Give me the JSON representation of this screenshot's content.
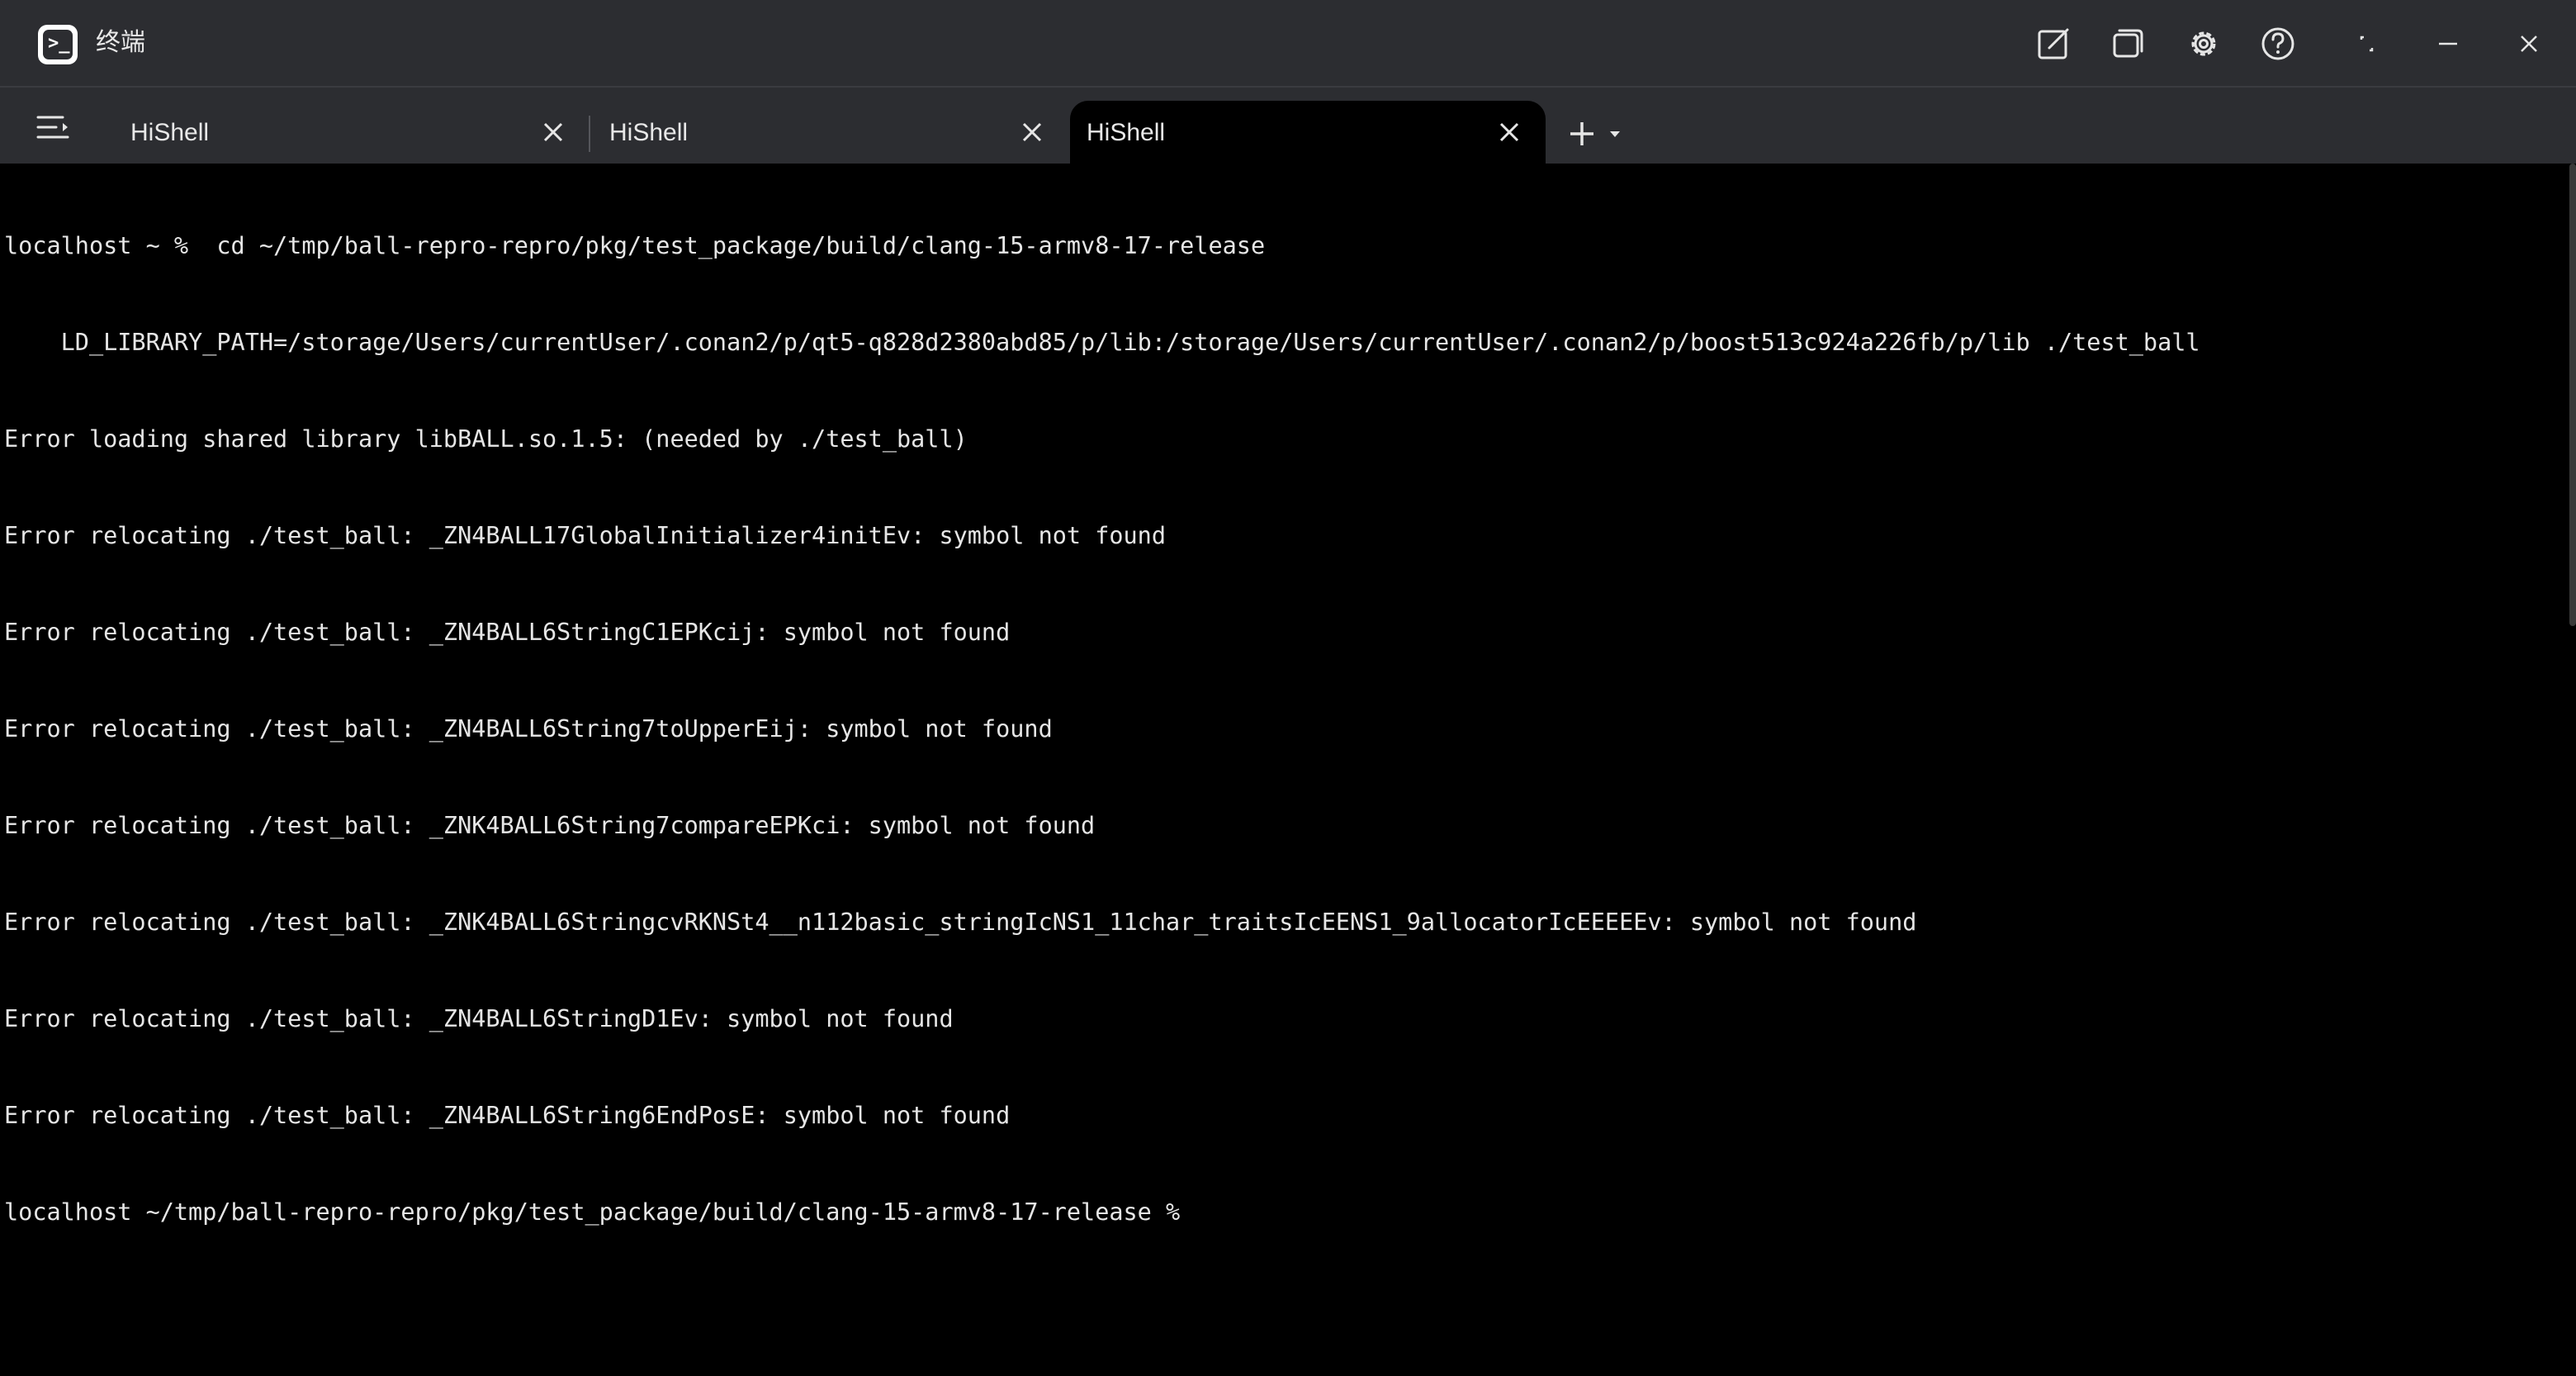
{
  "window": {
    "title": "终端",
    "app_icon": "terminal-app-icon",
    "controls": [
      {
        "name": "new-window-icon"
      },
      {
        "name": "split-windows-icon"
      },
      {
        "name": "settings-gear-icon"
      },
      {
        "name": "help-icon"
      },
      {
        "name": "restore-icon"
      },
      {
        "name": "minimize-icon"
      },
      {
        "name": "close-icon"
      }
    ]
  },
  "tabs": [
    {
      "label": "HiShell",
      "active": false
    },
    {
      "label": "HiShell",
      "active": false
    },
    {
      "label": "HiShell",
      "active": true
    }
  ],
  "tabbar": {
    "menu_icon": "tab-menu-icon",
    "add_icon": "add-tab-icon",
    "dropdown_icon": "dropdown-caret-icon"
  },
  "terminal": {
    "lines": [
      "localhost ~ %  cd ~/tmp/ball-repro-repro/pkg/test_package/build/clang-15-armv8-17-release",
      "    LD_LIBRARY_PATH=/storage/Users/currentUser/.conan2/p/qt5-q828d2380abd85/p/lib:/storage/Users/currentUser/.conan2/p/boost513c924a226fb/p/lib ./test_ball",
      "Error loading shared library libBALL.so.1.5: (needed by ./test_ball)",
      "Error relocating ./test_ball: _ZN4BALL17GlobalInitializer4initEv: symbol not found",
      "Error relocating ./test_ball: _ZN4BALL6StringC1EPKcij: symbol not found",
      "Error relocating ./test_ball: _ZN4BALL6String7toUpperEij: symbol not found",
      "Error relocating ./test_ball: _ZNK4BALL6String7compareEPKci: symbol not found",
      "Error relocating ./test_ball: _ZNK4BALL6StringcvRKNSt4__n112basic_stringIcNS1_11char_traitsIcEENS1_9allocatorIcEEEEEv: symbol not found",
      "Error relocating ./test_ball: _ZN4BALL6StringD1Ev: symbol not found",
      "Error relocating ./test_ball: _ZN4BALL6String6EndPosE: symbol not found",
      "localhost ~/tmp/ball-repro-repro/pkg/test_package/build/clang-15-armv8-17-release %"
    ]
  },
  "colors": {
    "titlebar_bg": "#2c2d31",
    "terminal_bg": "#000000",
    "terminal_fg": "#e6e6e6",
    "icon_color": "#e6e6e6"
  }
}
